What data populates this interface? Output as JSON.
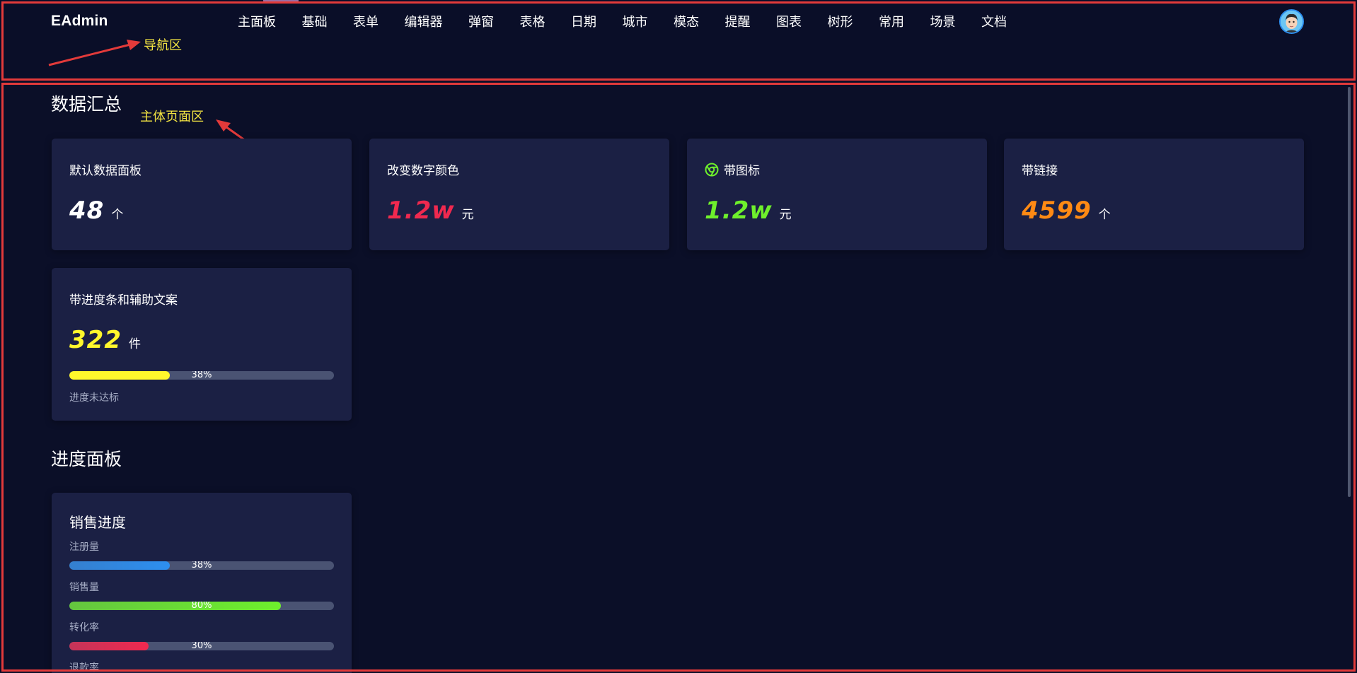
{
  "nav": {
    "logo": "EAdmin",
    "items": [
      "主面板",
      "基础",
      "表单",
      "编辑器",
      "弹窗",
      "表格",
      "日期",
      "城市",
      "模态",
      "提醒",
      "图表",
      "树形",
      "常用",
      "场景",
      "文档"
    ],
    "annotation": "导航区"
  },
  "main": {
    "annotation": "主体页面区",
    "section1_title": "数据汇总",
    "cards": [
      {
        "title": "默认数据面板",
        "value": "48",
        "unit": "个",
        "color": "#ffffff"
      },
      {
        "title": "改变数字颜色",
        "value": "1.2w",
        "unit": "元",
        "color": "#f0294f"
      },
      {
        "title": "带图标",
        "value": "1.2w",
        "unit": "元",
        "color": "#6ef02c",
        "icon": "chrome-icon",
        "icon_color": "#6ef02c"
      },
      {
        "title": "带链接",
        "value": "4599",
        "unit": "个",
        "color": "#ff8a14"
      }
    ],
    "progress_card": {
      "title": "带进度条和辅助文案",
      "value": "322",
      "unit": "件",
      "color": "#fff72c",
      "progress": 38,
      "progress_label": "38%",
      "progress_color": "#fff72c",
      "note": "进度未达标"
    },
    "section2_title": "进度面板",
    "panel": {
      "title": "销售进度",
      "rows": [
        {
          "label": "注册量",
          "percent": 38,
          "percent_label": "38%",
          "color": "#2d8ff0"
        },
        {
          "label": "销售量",
          "percent": 80,
          "percent_label": "80%",
          "color": "#6ef02c"
        },
        {
          "label": "转化率",
          "percent": 30,
          "percent_label": "30%",
          "color": "#f0294f"
        },
        {
          "label": "退款率"
        }
      ]
    }
  },
  "colors": {
    "background": "#0b0f28",
    "card": "#1b2044",
    "annotation": "#f4e542",
    "outline": "#e33a3a"
  }
}
